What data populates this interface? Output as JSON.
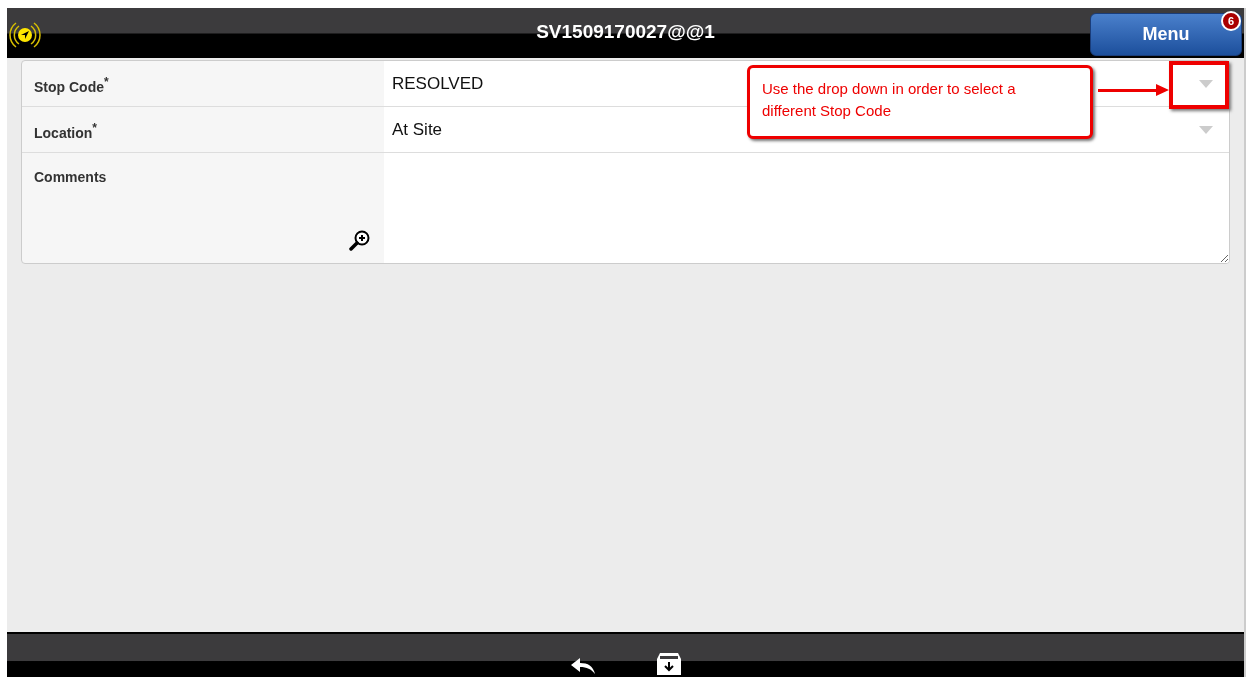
{
  "header": {
    "title": "SV1509170027@@1",
    "menu_button": {
      "label": "Menu",
      "badge": "6"
    }
  },
  "fields": [
    {
      "kind": "select",
      "label": "Stop Code",
      "required_mark": "*",
      "value": "RESOLVED"
    },
    {
      "kind": "select",
      "label": "Location",
      "required_mark": "*",
      "value": "At Site"
    },
    {
      "kind": "textarea",
      "label": "Comments"
    }
  ],
  "annotation": {
    "text": "Use the drop down in order to select a different Stop Code"
  }
}
